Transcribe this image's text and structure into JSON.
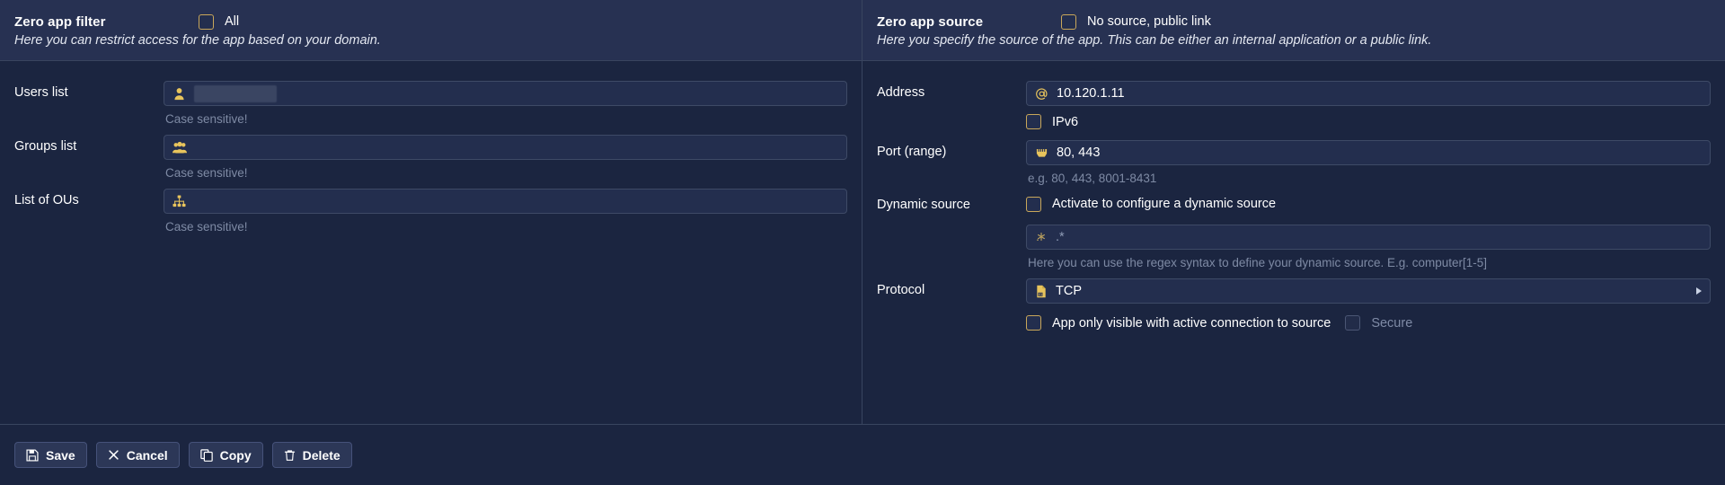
{
  "left_panel": {
    "title": "Zero app filter",
    "all_checkbox": {
      "label": "All",
      "checked": false
    },
    "description": "Here you can restrict access for the app based on your domain.",
    "fields": [
      {
        "label": "Users list",
        "icon": "user-icon",
        "value": "",
        "redacted": true,
        "hint": "Case sensitive!"
      },
      {
        "label": "Groups list",
        "icon": "users-group-icon",
        "value": "",
        "redacted": false,
        "hint": "Case sensitive!"
      },
      {
        "label": "List of OUs",
        "icon": "sitemap-icon",
        "value": "",
        "redacted": false,
        "hint": "Case sensitive!"
      }
    ]
  },
  "right_panel": {
    "title": "Zero app source",
    "no_source_checkbox": {
      "label": "No source, public link",
      "checked": false
    },
    "description": "Here you specify the source of the app. This can be either an internal application or a public link.",
    "address": {
      "label": "Address",
      "icon": "at-sign-icon",
      "value": "10.120.1.11"
    },
    "ipv6_checkbox": {
      "label": "IPv6",
      "checked": false
    },
    "port": {
      "label": "Port (range)",
      "icon": "ethernet-port-icon",
      "value": "80, 443",
      "hint": "e.g. 80, 443, 8001-8431"
    },
    "dynamic_source": {
      "label": "Dynamic source",
      "checkbox_label": "Activate to configure a dynamic source",
      "checked": false,
      "regex_icon": "asterisk-icon",
      "regex_placeholder": ".*",
      "hint": "Here you can use the regex syntax to define your dynamic source. E.g. computer[1-5]"
    },
    "protocol": {
      "label": "Protocol",
      "icon": "binary-file-icon",
      "value": "TCP",
      "caret": "chevron-right-icon"
    },
    "active_connection_checkbox": {
      "label": "App only visible with active connection to source",
      "checked": false
    },
    "secure_checkbox": {
      "label": "Secure",
      "checked": false,
      "disabled": true
    }
  },
  "footer": {
    "buttons": [
      {
        "label": "Save",
        "icon": "save-floppy-icon"
      },
      {
        "label": "Cancel",
        "icon": "close-x-icon"
      },
      {
        "label": "Copy",
        "icon": "copy-icon"
      },
      {
        "label": "Delete",
        "icon": "trash-icon"
      }
    ]
  },
  "colors": {
    "background": "#1b2540",
    "header_band": "#273152",
    "input_bg": "#232e4e",
    "accent_yellow": "#e8c45c",
    "border": "#3e4a66",
    "muted_text": "#7e8aa4"
  }
}
